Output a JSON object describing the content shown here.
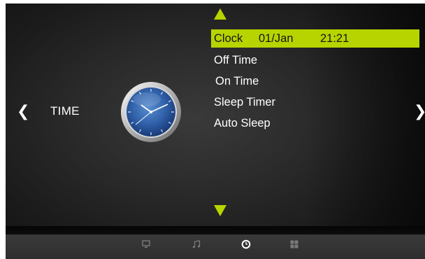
{
  "section": {
    "label": "TIME"
  },
  "nav": {
    "left_arrow": "❮",
    "right_arrow": "❯"
  },
  "menu": {
    "items": [
      {
        "label": "Clock",
        "date": "01/Jan",
        "time": "21:21",
        "selected": true
      },
      {
        "label": "Off Time"
      },
      {
        "label": "On Time"
      },
      {
        "label": "Sleep Timer"
      },
      {
        "label": "Auto Sleep"
      }
    ]
  },
  "bottom_bar": {
    "icons": [
      "tv-icon",
      "music-note-icon",
      "clock-icon",
      "grid-apps-icon"
    ],
    "active": "clock-icon"
  },
  "colors": {
    "accent": "#b7d400",
    "text": "#ffffff",
    "selected_text": "#151515",
    "icon_inactive": "#7a7a7a",
    "icon_active": "#ffffff"
  }
}
